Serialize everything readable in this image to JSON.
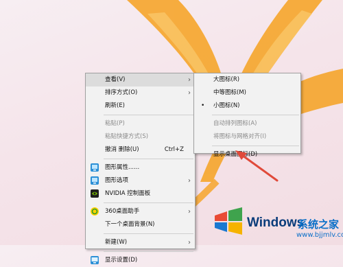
{
  "context_menu": {
    "items": [
      {
        "label": "查看(V)"
      },
      {
        "label": "排序方式(O)"
      },
      {
        "label": "刷新(E)"
      },
      {
        "label": "粘贴(P)"
      },
      {
        "label": "粘贴快捷方式(S)"
      },
      {
        "label": "撤消 删除(U)",
        "shortcut": "Ctrl+Z"
      },
      {
        "label": "图形属性......"
      },
      {
        "label": "图形选项"
      },
      {
        "label": "NVIDIA 控制面板"
      },
      {
        "label": "360桌面助手"
      },
      {
        "label": "下一个桌面背景(N)"
      },
      {
        "label": "新建(W)"
      },
      {
        "label": "显示设置(D)"
      }
    ]
  },
  "view_submenu": {
    "items": [
      {
        "label": "大图标(R)"
      },
      {
        "label": "中等图标(M)"
      },
      {
        "label": "小图标(N)",
        "bullet": "•"
      },
      {
        "label": "自动排列图标(A)"
      },
      {
        "label": "将图标与网格对齐(I)"
      },
      {
        "label": "显示桌面图标(D)"
      }
    ]
  },
  "watermark": {
    "title": "Windows",
    "subtitle": "系统之家",
    "url": "www.bjjmlv.com"
  },
  "colors": {
    "petal_orange": "#f6a935",
    "arrow_red": "#e04a3a",
    "windows_blue": "#0a6fc8"
  },
  "icons": [
    "graphics-properties-icon",
    "graphics-options-icon",
    "nvidia-icon",
    "360-assistant-icon",
    "display-settings-icon"
  ]
}
